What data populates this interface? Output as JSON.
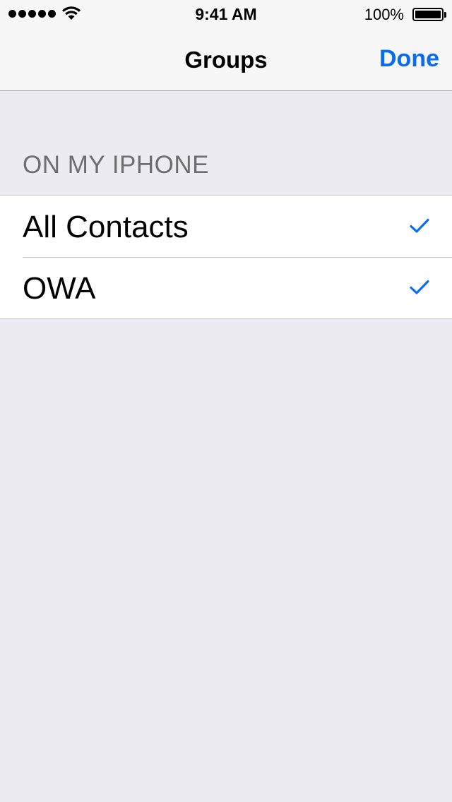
{
  "status_bar": {
    "time": "9:41 AM",
    "battery_percent": "100%",
    "signal_bars": 5,
    "icons": [
      "signal-dots-icon",
      "wifi-icon",
      "battery-icon"
    ]
  },
  "nav": {
    "title": "Groups",
    "done_label": "Done"
  },
  "section": {
    "header": "ON MY IPHONE",
    "items": [
      {
        "label": "All Contacts",
        "checked": true
      },
      {
        "label": "OWA",
        "checked": true
      }
    ]
  },
  "colors": {
    "accent": "#0A6CF0",
    "background": "#EBEBF1",
    "section_header": "#6D6D72",
    "separator": "#C8C7CC"
  }
}
